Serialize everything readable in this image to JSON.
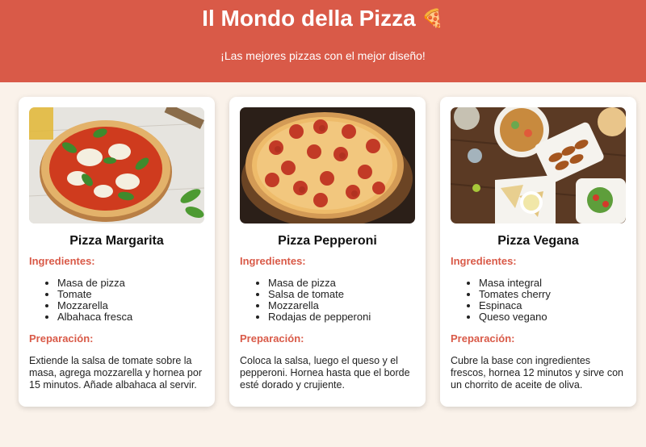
{
  "header": {
    "title": "Il Mondo della Pizza",
    "title_emoji": "🍕",
    "subtitle": "¡Las mejores pizzas con el mejor diseño!"
  },
  "colors": {
    "brand": "#d95a48",
    "background": "#faf2ea"
  },
  "cards": [
    {
      "name": "Pizza Margarita",
      "image": "margherita-pizza-photo",
      "ingredients_label": "Ingredientes:",
      "ingredients": [
        "Masa de pizza",
        "Tomate",
        "Mozzarella",
        "Albahaca fresca"
      ],
      "preparation_label": "Preparación:",
      "preparation": "Extiende la salsa de tomate sobre la masa, agrega mozzarella y hornea por 15 minutos. Añade albahaca al servir."
    },
    {
      "name": "Pizza Pepperoni",
      "image": "pepperoni-pizza-photo",
      "ingredients_label": "Ingredientes:",
      "ingredients": [
        "Masa de pizza",
        "Salsa de tomate",
        "Mozzarella",
        "Rodajas de pepperoni"
      ],
      "preparation_label": "Preparación:",
      "preparation": "Coloca la salsa, luego el queso y el pepperoni. Hornea hasta que el borde esté dorado y crujiente."
    },
    {
      "name": "Pizza Vegana",
      "image": "vegan-food-table-photo",
      "ingredients_label": "Ingredientes:",
      "ingredients": [
        "Masa integral",
        "Tomates cherry",
        "Espinaca",
        "Queso vegano"
      ],
      "preparation_label": "Preparación:",
      "preparation": "Cubre la base con ingredientes frescos, hornea 12 minutos y sirve con un chorrito de aceite de oliva."
    }
  ]
}
